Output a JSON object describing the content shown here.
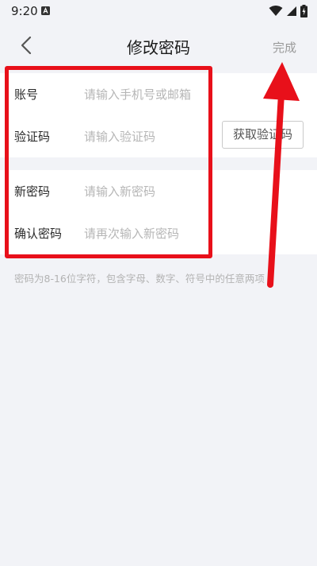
{
  "status_bar": {
    "time": "9:20",
    "icons": [
      "notification-a-icon",
      "wifi-icon",
      "signal-icon",
      "battery-charging-icon"
    ]
  },
  "header": {
    "title": "修改密码",
    "done_label": "完成",
    "back_icon": "chevron-left-icon"
  },
  "form": {
    "account": {
      "label": "账号",
      "placeholder": "请输入手机号或邮箱",
      "value": ""
    },
    "code": {
      "label": "验证码",
      "placeholder": "请输入验证码",
      "value": "",
      "button_label": "获取验证码"
    },
    "new_password": {
      "label": "新密码",
      "placeholder": "请输入新密码",
      "value": ""
    },
    "confirm_password": {
      "label": "确认密码",
      "placeholder": "请再次输入新密码",
      "value": ""
    }
  },
  "hint": "密码为8-16位字符，包含字母、数字、符号中的任意两项",
  "colors": {
    "background": "#f2f3f7",
    "annotation": "#e8101a",
    "placeholder": "#b6b6b6"
  }
}
